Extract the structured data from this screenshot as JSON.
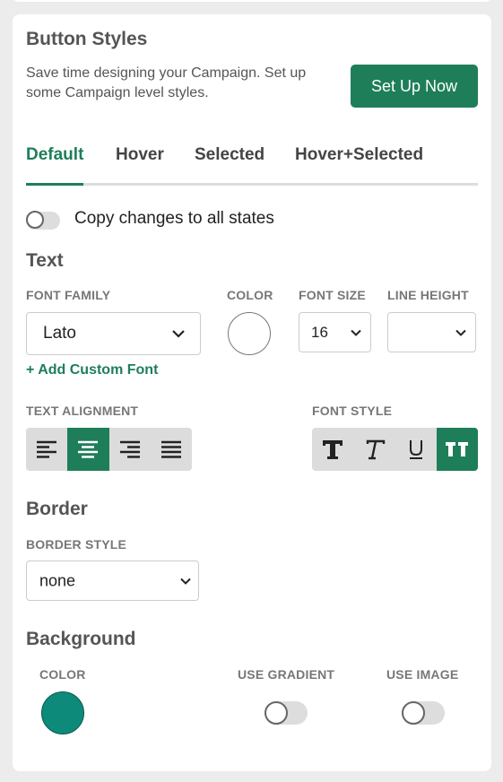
{
  "button_styles": {
    "title": "Button Styles",
    "description": "Save time designing your Campaign. Set up some Campaign level styles.",
    "setup_label": "Set Up Now"
  },
  "tabs": [
    {
      "label": "Default",
      "active": true
    },
    {
      "label": "Hover",
      "active": false
    },
    {
      "label": "Selected",
      "active": false
    },
    {
      "label": "Hover+Selected",
      "active": false
    }
  ],
  "copy_changes": {
    "label": "Copy changes to all states",
    "on": false
  },
  "text_section": {
    "title": "Text",
    "font_family_label": "FONT FAMILY",
    "font_family_value": "Lato",
    "color_label": "COLOR",
    "text_color": "#ffffff",
    "font_size_label": "FONT SIZE",
    "font_size_value": "16",
    "line_height_label": "LINE HEIGHT",
    "line_height_value": "",
    "add_font_label": "+ Add Custom Font",
    "alignment_label": "TEXT ALIGNMENT",
    "alignment_options": [
      "align-left",
      "align-center",
      "align-right",
      "align-justify"
    ],
    "alignment_selected": "align-center",
    "font_style_label": "FONT STYLE",
    "font_style_options": [
      "bold",
      "italic",
      "underline",
      "uppercase"
    ],
    "font_style_active": [
      "uppercase"
    ]
  },
  "border_section": {
    "title": "Border",
    "style_label": "BORDER STYLE",
    "style_value": "none"
  },
  "background_section": {
    "title": "Background",
    "color_label": "COLOR",
    "color_value": "#0e8a7a",
    "gradient_label": "USE GRADIENT",
    "gradient_on": false,
    "image_label": "USE IMAGE",
    "image_on": false
  },
  "colors": {
    "accent": "#1e7e5a",
    "background_swatch": "#0e8a7a"
  }
}
